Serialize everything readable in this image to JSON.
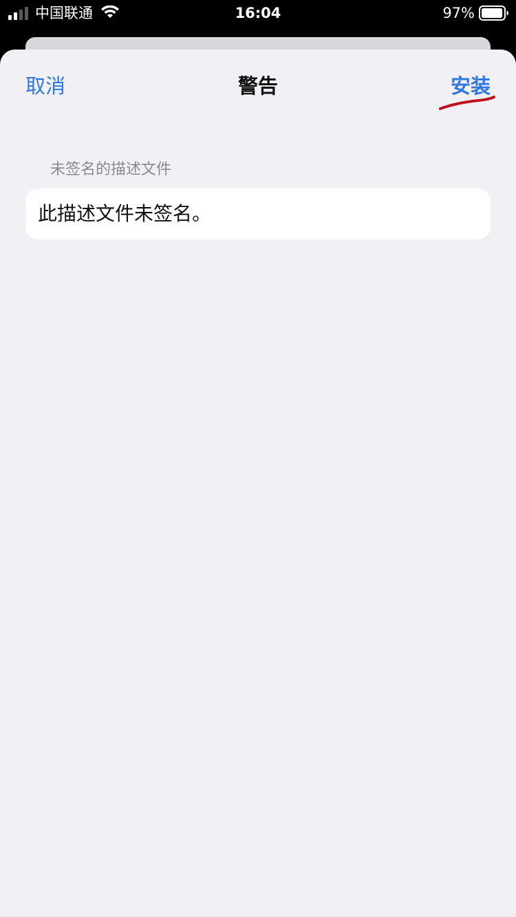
{
  "status_bar": {
    "carrier": "中国联通",
    "time": "16:04",
    "battery_percent": "97%",
    "battery_level": 0.97,
    "signal_bars_active": 2,
    "signal_bars_total": 4,
    "signal_icon": "cellular-signal-icon",
    "wifi_icon": "wifi-icon",
    "battery_icon": "battery-icon"
  },
  "nav": {
    "cancel_label": "取消",
    "title": "警告",
    "install_label": "安装"
  },
  "section": {
    "header": "未签名的描述文件",
    "message": "此描述文件未签名。"
  },
  "colors": {
    "accent": "#2e78e6",
    "sheet_background": "#f1f0f5",
    "annotation": "#c0111f"
  }
}
